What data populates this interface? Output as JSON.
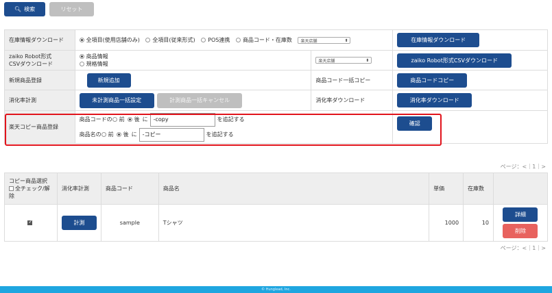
{
  "toolbar": {
    "search_label": "検索",
    "search_icon": "search-icon",
    "reset_label": "リセット"
  },
  "form": {
    "rows": {
      "download": {
        "label": "在庫情報ダウンロード",
        "options": [
          "全項目(使用店舗のみ)",
          "全項目(従来形式)",
          "POS連携",
          "商品コード・在庫数"
        ],
        "store_select": "楽天店舗",
        "button": "在庫情報ダウンロード"
      },
      "csv": {
        "label_line1": "zaiko Robot形式",
        "label_line2": "CSVダウンロード",
        "options": [
          "商品情報",
          "規格情報"
        ],
        "store_select": "楽天店舗",
        "button": "zaiko Robot形式CSVダウンロード"
      },
      "new": {
        "label": "新規商品登録",
        "button": "新規追加",
        "copy_label": "商品コード一括コピー",
        "copy_button": "商品コードコピー"
      },
      "consumption": {
        "label": "消化率計測",
        "button1": "未計測商品一括設定",
        "button2": "計測商品一括キャンセル",
        "dl_label": "消化率ダウンロード",
        "dl_button": "消化率ダウンロード"
      },
      "rakuten_copy": {
        "label": "楽天コピー商品登録",
        "code_prefix": "商品コードの",
        "name_prefix": "商品名の",
        "before": "前",
        "after": "後",
        "ni": "に",
        "code_value": "-copy",
        "name_value": "-コピー",
        "suffix": "を追記する",
        "confirm": "確認"
      }
    }
  },
  "pager": {
    "text": "ページ：<｜1｜>"
  },
  "list": {
    "headers": {
      "select_line1": "コピー商品選択",
      "select_line2": "全チェック/解",
      "select_line3": "除",
      "measure": "消化率計測",
      "code": "商品コード",
      "name": "商品名",
      "price": "単価",
      "stock": "在庫数"
    },
    "rows": [
      {
        "measure_button": "計測",
        "code": "sample",
        "name": "Tシャツ",
        "price": "1000",
        "stock": "10",
        "detail_button": "詳細",
        "delete_button": "削除"
      }
    ]
  },
  "footer": {
    "copyright": "© Hunglead, Inc."
  }
}
